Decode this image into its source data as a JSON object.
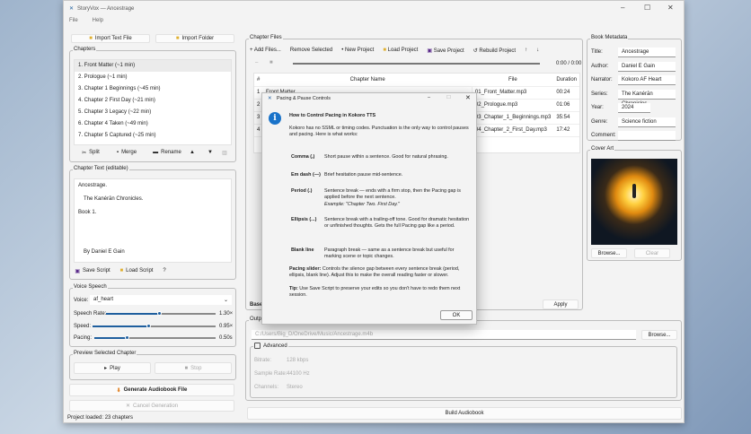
{
  "window": {
    "title": "StoryVox — Ancestrage",
    "menu": [
      "File",
      "Help"
    ]
  },
  "left": {
    "import_text": "Import Text File",
    "import_folder": "Import Folder",
    "chapters_label": "Chapters",
    "chapters": [
      "1. Front Matter  (~1 min)",
      "2. Prologue  (~1 min)",
      "3. Chapter 1 Beginnings  (~45 min)",
      "4. Chapter 2 First Day  (~21 min)",
      "5. Chapter 3 Legacy  (~22 min)",
      "6. Chapter 4 Taken  (~49 min)",
      "7. Chapter 5 Captured  (~25 min)"
    ],
    "split": "Split",
    "merge": "Merge",
    "rename": "Rename",
    "chapter_text_label": "Chapter Text (editable)",
    "chapter_text": [
      "Ancestrage.",
      "The Kanérān Chronicles.",
      "Book 1.",
      "By Daniel E Gain"
    ],
    "save_script": "Save Script",
    "load_script": "Load Script",
    "help": "?",
    "voice_label": "Voice  Speech",
    "voice_field": "Voice:",
    "voice_value": "af_heart",
    "speech_rate_label": "Speech Rate:",
    "speech_rate": "1.30×",
    "speech_rate_fraction": 0.48,
    "speed_label": "Speed:",
    "speed": "0.95×",
    "speed_fraction": 0.45,
    "pacing_label": "Pacing:",
    "pacing": "0.50s",
    "pacing_fraction": 0.27,
    "preview_label": "Preview Selected Chapter",
    "play": "Play",
    "stop": "Stop",
    "generate": "Generate Audiobook File",
    "cancel": "Cancel Generation",
    "status": "Project loaded: 23 chapters"
  },
  "middle": {
    "chapter_files_label": "Chapter Files",
    "toolbar": [
      "+ Add Files...",
      "Remove Selected",
      "• New Project",
      "Load Project",
      "Save Project",
      "↺ Rebuild Project",
      "↑",
      "↓"
    ],
    "time": "0:00 / 0:00",
    "columns": [
      "#",
      "Chapter Name",
      "File",
      "Duration"
    ],
    "rows": [
      [
        "1",
        "Front Matter",
        "01_Front_Matter.mp3",
        "00:24"
      ],
      [
        "2",
        "",
        "02_Prologue.mp3",
        "01:06"
      ],
      [
        "3",
        "",
        "03_Chapter_1_Beginnings.mp3",
        "35:54"
      ],
      [
        "4",
        "",
        "04_Chapter_2_First_Day.mp3",
        "17:42"
      ]
    ],
    "base_label": "Base",
    "apply": "Apply",
    "output_label": "Output",
    "output_path": "C:/Users/Big_D/OneDrive/Music/Ancestrage.m4b",
    "browse": "Browse...",
    "advanced": "Advanced",
    "bitrate_label": "Bitrate:",
    "bitrate": "128 kbps",
    "sample_rate_label": "Sample Rate:",
    "sample_rate": "44100 Hz",
    "channels_label": "Channels:",
    "channels": "Stereo",
    "build": "Build Audiobook"
  },
  "right": {
    "metadata_label": "Book Metadata",
    "fields": [
      {
        "label": "Title:",
        "value": "Ancestrage"
      },
      {
        "label": "Author:",
        "value": "Daniel E Gain"
      },
      {
        "label": "Narrator:",
        "value": "Kokoro AF Heart"
      },
      {
        "label": "Series:",
        "value": "The Kanérān Chronicles"
      },
      {
        "label": "Year:",
        "value": "2024"
      },
      {
        "label": "Genre:",
        "value": "Science fiction"
      },
      {
        "label": "Comment:",
        "value": ""
      }
    ],
    "cover_label": "Cover Art",
    "browse": "Browse...",
    "clear": "Clear"
  },
  "dialog": {
    "title": "Pacing & Pause Controls",
    "heading": "How to Control Pacing in Kokoro TTS",
    "intro": "Kokoro has no SSML or timing codes. Punctuation is the only way to control pauses and pacing. Here is what works:",
    "items": [
      {
        "term": "Comma (,)",
        "desc": "Short pause within a sentence. Good for natural phrasing."
      },
      {
        "term": "Em dash (—)",
        "desc": "Brief hesitation pause mid-sentence."
      },
      {
        "term": "Period (.)",
        "desc": "Sentence break — ends with a firm stop, then the Pacing gap is applied before the next sentence.",
        "example": "Example:  \"Chapter Two. First Day.\""
      },
      {
        "term": "Ellipsis (...)",
        "desc": "Sentence break with a trailing-off tone. Good for dramatic hesitation or unfinished thoughts. Gets the full Pacing gap like a period."
      },
      {
        "term": "Blank line",
        "desc": "Paragraph break — same as a sentence break but useful for marking scene or topic changes."
      }
    ],
    "slider_term": "Pacing slider:",
    "slider_desc": "Controls the silence gap between every sentence break (period, ellipsis, blank line). Adjust this to make the overall reading faster or slower.",
    "tip_term": "Tip:",
    "tip_desc": "Use Save Script to preserve your edits so you don't have to redo them next session.",
    "ok": "OK"
  },
  "colors": {
    "accent": "#1f5f9e",
    "info": "#1a73c9"
  }
}
